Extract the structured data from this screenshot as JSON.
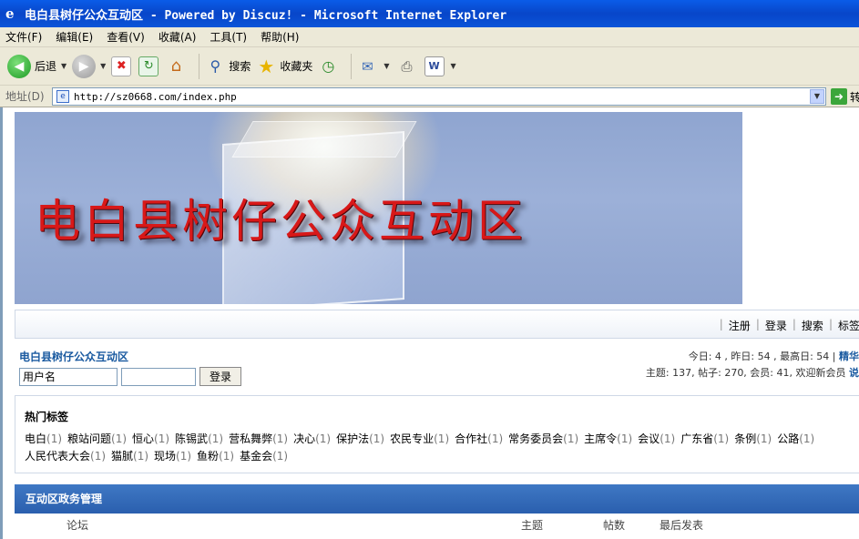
{
  "window": {
    "title": "电白县树仔公众互动区 - Powered by Discuz! - Microsoft Internet Explorer"
  },
  "menubar": [
    "文件(F)",
    "编辑(E)",
    "查看(V)",
    "收藏(A)",
    "工具(T)",
    "帮助(H)"
  ],
  "toolbar": {
    "back": "后退",
    "search": "搜索",
    "favorites": "收藏夹"
  },
  "address": {
    "label": "地址(D)",
    "url": "http://sz0668.com/index.php",
    "go": "转"
  },
  "page": {
    "banner_title": "电白县树仔公众互动区",
    "nav": [
      "注册",
      "登录",
      "搜索",
      "标签"
    ],
    "forum_name": "电白县树仔公众互动区",
    "login": {
      "username_placeholder": "用户名",
      "button": "登录"
    },
    "stats": {
      "line1": "今日: 4 , 昨日: 54 , 最高日: 54 |",
      "line1_link": "精华",
      "line2": "主题: 137, 帖子: 270, 会员: 41, 欢迎新会员",
      "line2_link": "说"
    },
    "tags_title": "热门标签",
    "tags": [
      {
        "name": "电白",
        "count": "(1)"
      },
      {
        "name": "粮站问题",
        "count": "(1)"
      },
      {
        "name": "恒心",
        "count": "(1)"
      },
      {
        "name": "陈锡武",
        "count": "(1)"
      },
      {
        "name": "营私舞弊",
        "count": "(1)"
      },
      {
        "name": "决心",
        "count": "(1)"
      },
      {
        "name": "保护法",
        "count": "(1)"
      },
      {
        "name": "农民专业",
        "count": "(1)"
      },
      {
        "name": "合作社",
        "count": "(1)"
      },
      {
        "name": "常务委员会",
        "count": "(1)"
      },
      {
        "name": "主席令",
        "count": "(1)"
      },
      {
        "name": "会议",
        "count": "(1)"
      },
      {
        "name": "广东省",
        "count": "(1)"
      },
      {
        "name": "条例",
        "count": "(1)"
      },
      {
        "name": "公路",
        "count": "(1)"
      },
      {
        "name": "人民代表大会",
        "count": "(1)"
      },
      {
        "name": "猫腻",
        "count": "(1)"
      },
      {
        "name": "现场",
        "count": "(1)"
      },
      {
        "name": "鱼粉",
        "count": "(1)"
      },
      {
        "name": "基金会",
        "count": "(1)"
      }
    ],
    "panel_title": "互动区政务管理",
    "columns": {
      "forum": "论坛",
      "topics": "主题",
      "posts": "帖数",
      "last_post": "最后发表"
    }
  }
}
